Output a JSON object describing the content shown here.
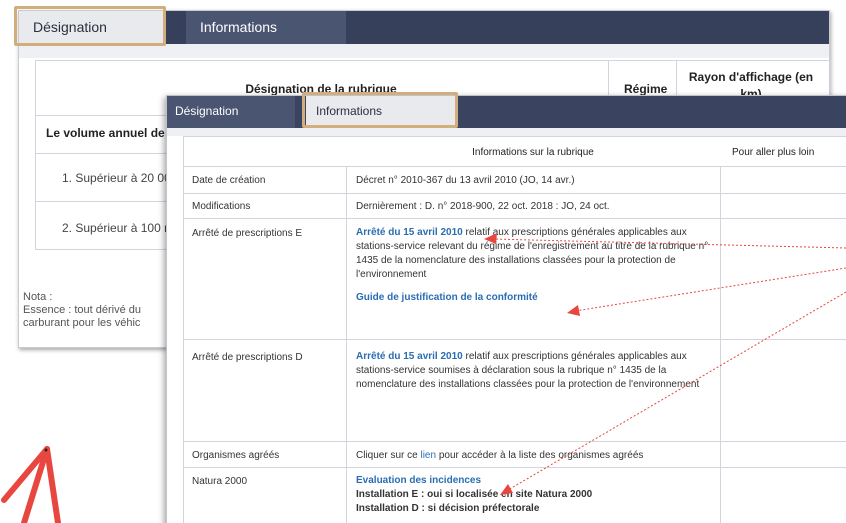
{
  "back_window": {
    "tabs": [
      {
        "label": "Désignation",
        "active": true
      },
      {
        "label": "Informations",
        "active": false
      }
    ],
    "table": {
      "headers": [
        "Désignation de la rubrique",
        "Régime",
        "Rayon d'affichage (en km)"
      ],
      "rows": [
        "Le volume annuel de",
        "1. Supérieur à 20 00",
        "2. Supérieur à 100 r"
      ]
    },
    "nota": {
      "label": "Nota :",
      "line1": "Essence : tout dérivé du",
      "line2": "carburant pour les véhic"
    }
  },
  "front_window": {
    "tabs": [
      {
        "label": "Désignation",
        "active": false
      },
      {
        "label": "Informations",
        "active": true
      }
    ],
    "table": {
      "headers": [
        "Informations sur la rubrique",
        "Pour aller plus loin"
      ],
      "rows": [
        {
          "label": "Date de création",
          "value": "Décret n° 2010-367 du 13 avril 2010 (JO, 14 avr.)"
        },
        {
          "label": "Modifications",
          "value": "Dernièrement : D. n° 2018-900, 22 oct. 2018 : JO, 24 oct."
        },
        {
          "label": "Arrêté de prescriptions E",
          "link": "Arrêté du 15 avril 2010",
          "text": " relatif aux prescriptions générales applicables aux stations-service relevant du régime de l'enregistrement au titre de la rubrique n° 1435 de la nomenclature des installations classées pour la protection de l'environnement",
          "link2": "Guide de justification de la conformité"
        },
        {
          "label": "Arrêté de prescriptions D",
          "link": "Arrêté du 15 avril 2010",
          "text": " relatif aux prescriptions générales applicables aux stations-service soumises à déclaration sous la rubrique n° 1435 de la nomenclature des installations classées pour la protection de l'environnement"
        },
        {
          "label": "Organismes agréés",
          "text_before": "Cliquer sur ce ",
          "link": "lien",
          "text_after": " pour accéder à la liste des organismes agréés"
        },
        {
          "label": "Natura 2000",
          "link": "Evaluation des incidences",
          "line1": "Installation E : oui si localisée en site Natura 2000",
          "line2": "Installation D : si décision préfectorale"
        }
      ]
    }
  },
  "colors": {
    "tabbar": "#37405a",
    "highlight": "#d2ae7c",
    "arrow": "#e8473f",
    "link": "#2a6db3"
  }
}
